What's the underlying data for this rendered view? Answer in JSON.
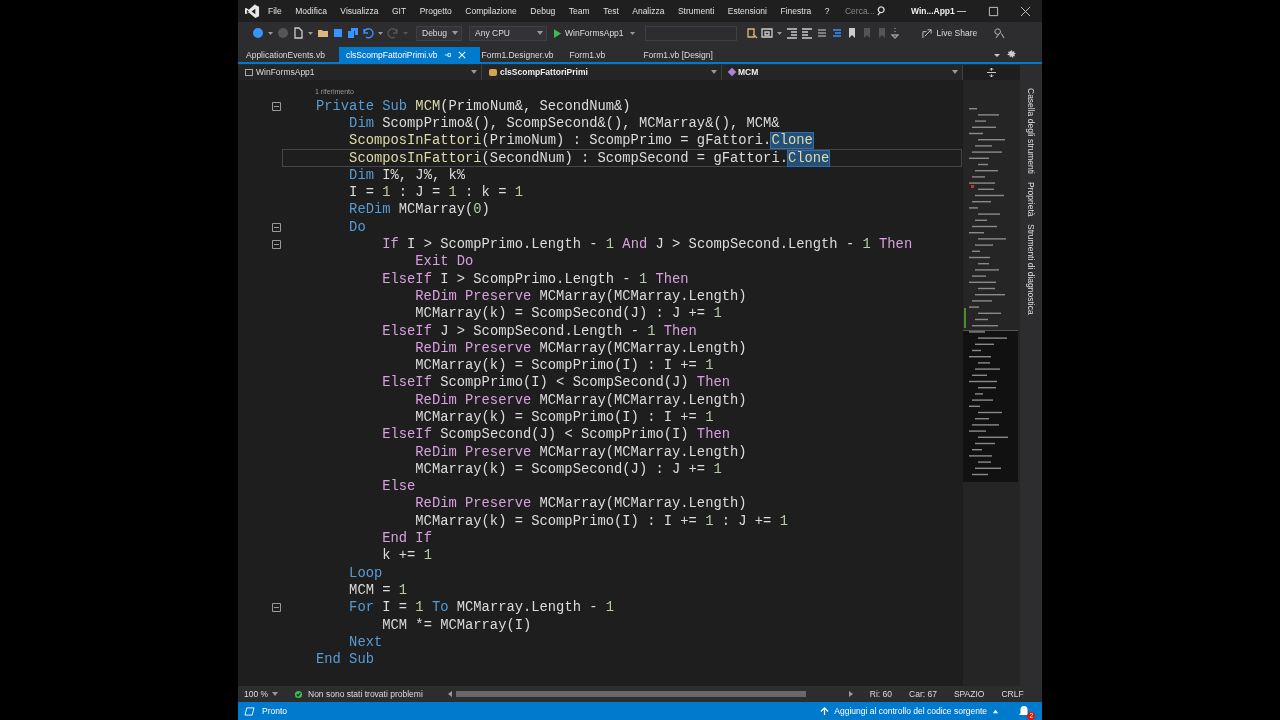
{
  "window": {
    "title": "Win...App1"
  },
  "menu": [
    "File",
    "Modifica",
    "Visualizza",
    "GIT",
    "Progetto",
    "Compilazione",
    "Debug",
    "Team",
    "Test",
    "Analizza",
    "Strumenti",
    "Estensioni",
    "Finestra",
    "?"
  ],
  "search": {
    "placeholder": "Cerca..."
  },
  "toolbar": {
    "configuration": "Debug",
    "platform": "Any CPU",
    "start": "WinFormsApp1",
    "live_share": "Live Share"
  },
  "tabs": [
    {
      "label": "ApplicationEvents.vb",
      "selected": false
    },
    {
      "label": "clsScompFattoriPrimi.vb",
      "selected": true
    },
    {
      "label": "Form1.Designer.vb",
      "selected": false
    },
    {
      "label": "Form1.vb",
      "selected": false
    },
    {
      "label": "Form1.vb [Design]",
      "selected": false
    }
  ],
  "nav_bar": {
    "project": "WinFormsApp1",
    "class": "clsScompFattoriPrimi",
    "member": "MCM"
  },
  "editor": {
    "annotation": "1 riferimento",
    "lines": [
      {
        "fold": true,
        "selected": false,
        "tokens": [
          {
            "kind": "kw",
            "text": "Private Sub "
          },
          {
            "kind": "fn",
            "text": "MCM"
          },
          {
            "kind": "tx",
            "text": "(PrimoNum&, SecondNum&)"
          }
        ],
        "children": [
          {
            "fold": false,
            "selected": false,
            "tokens": [
              {
                "kind": "kw",
                "text": "Dim "
              },
              {
                "kind": "tx",
                "text": "ScompPrimo&(), ScompSecond&(), MCMarray&(), MCM&"
              }
            ]
          },
          {
            "fold": false,
            "selected": false,
            "tokens": [
              {
                "kind": "fn",
                "text": "ScomposInFattori"
              },
              {
                "kind": "tx",
                "text": "(PrimoNum) : ScompPrimo = gFattori."
              },
              {
                "kind": "hl",
                "text": "Clone"
              }
            ]
          },
          {
            "fold": false,
            "selected": true,
            "tokens": [
              {
                "kind": "fn",
                "text": "ScomposInFattori"
              },
              {
                "kind": "tx",
                "text": "(SecondNum) : ScompSecond = gFattori."
              },
              {
                "kind": "hl",
                "text": "Clone"
              }
            ]
          },
          {
            "fold": false,
            "selected": false,
            "tokens": [
              {
                "kind": "kw",
                "text": "Dim "
              },
              {
                "kind": "tx",
                "text": "I%, J%, k%"
              }
            ]
          },
          {
            "fold": false,
            "selected": false,
            "tokens": [
              {
                "kind": "tx",
                "text": "I = "
              },
              {
                "kind": "num",
                "text": "1"
              },
              {
                "kind": "tx",
                "text": " : J = "
              },
              {
                "kind": "num",
                "text": "1"
              },
              {
                "kind": "tx",
                "text": " : k = "
              },
              {
                "kind": "num",
                "text": "1"
              }
            ]
          },
          {
            "fold": false,
            "selected": false,
            "tokens": [
              {
                "kind": "kw",
                "text": "ReDim "
              },
              {
                "kind": "tx",
                "text": "MCMarray("
              },
              {
                "kind": "num",
                "text": "0"
              },
              {
                "kind": "tx",
                "text": ")"
              }
            ]
          },
          {
            "fold": true,
            "selected": false,
            "tokens": [
              {
                "kind": "kw",
                "text": "Do"
              }
            ],
            "children": [
              {
                "fold": true,
                "selected": false,
                "tokens": [
                  {
                    "kind": "ctl",
                    "text": "If "
                  },
                  {
                    "kind": "tx",
                    "text": "I > ScompPrimo.Length - "
                  },
                  {
                    "kind": "num",
                    "text": "1"
                  },
                  {
                    "kind": "ctl",
                    "text": " And "
                  },
                  {
                    "kind": "tx",
                    "text": "J > ScompSecond.Length - "
                  },
                  {
                    "kind": "num",
                    "text": "1"
                  },
                  {
                    "kind": "ctl",
                    "text": " Then"
                  }
                ],
                "children": [
                  {
                    "fold": false,
                    "selected": false,
                    "tokens": [
                      {
                        "kind": "ctl",
                        "text": "Exit Do"
                      }
                    ]
                  }
                ]
              },
              {
                "fold": false,
                "selected": false,
                "tokens": [
                  {
                    "kind": "ctl",
                    "text": "ElseIf "
                  },
                  {
                    "kind": "tx",
                    "text": "I > ScompPrimo.Length - "
                  },
                  {
                    "kind": "num",
                    "text": "1"
                  },
                  {
                    "kind": "ctl",
                    "text": " Then"
                  }
                ],
                "children": [
                  {
                    "fold": false,
                    "selected": false,
                    "tokens": [
                      {
                        "kind": "ctl",
                        "text": "ReDim Preserve "
                      },
                      {
                        "kind": "tx",
                        "text": "MCMarray(MCMarray.Length)"
                      }
                    ]
                  },
                  {
                    "fold": false,
                    "selected": false,
                    "tokens": [
                      {
                        "kind": "tx",
                        "text": "MCMarray(k) = ScompSecond(J) : J += "
                      },
                      {
                        "kind": "num",
                        "text": "1"
                      }
                    ]
                  }
                ]
              },
              {
                "fold": false,
                "selected": false,
                "tokens": [
                  {
                    "kind": "ctl",
                    "text": "ElseIf "
                  },
                  {
                    "kind": "tx",
                    "text": "J > ScompSecond.Length - "
                  },
                  {
                    "kind": "num",
                    "text": "1"
                  },
                  {
                    "kind": "ctl",
                    "text": " Then"
                  }
                ],
                "children": [
                  {
                    "fold": false,
                    "selected": false,
                    "tokens": [
                      {
                        "kind": "ctl",
                        "text": "ReDim Preserve "
                      },
                      {
                        "kind": "tx",
                        "text": "MCMarray(MCMarray.Length)"
                      }
                    ]
                  },
                  {
                    "fold": false,
                    "selected": false,
                    "tokens": [
                      {
                        "kind": "tx",
                        "text": "MCMarray(k) = ScompPrimo(I) : I += "
                      },
                      {
                        "kind": "num",
                        "text": "1"
                      }
                    ]
                  }
                ]
              },
              {
                "fold": false,
                "selected": false,
                "tokens": [
                  {
                    "kind": "ctl",
                    "text": "ElseIf "
                  },
                  {
                    "kind": "tx",
                    "text": "ScompPrimo(I) < ScompSecond(J)"
                  },
                  {
                    "kind": "ctl",
                    "text": " Then"
                  }
                ],
                "children": [
                  {
                    "fold": false,
                    "selected": false,
                    "tokens": [
                      {
                        "kind": "ctl",
                        "text": "ReDim Preserve "
                      },
                      {
                        "kind": "tx",
                        "text": "MCMarray(MCMarray.Length)"
                      }
                    ]
                  },
                  {
                    "fold": false,
                    "selected": false,
                    "tokens": [
                      {
                        "kind": "tx",
                        "text": "MCMarray(k) = ScompPrimo(I) : I += "
                      },
                      {
                        "kind": "num",
                        "text": "1"
                      }
                    ]
                  }
                ]
              },
              {
                "fold": false,
                "selected": false,
                "tokens": [
                  {
                    "kind": "ctl",
                    "text": "ElseIf "
                  },
                  {
                    "kind": "tx",
                    "text": "ScompSecond(J) < ScompPrimo(I)"
                  },
                  {
                    "kind": "ctl",
                    "text": " Then"
                  }
                ],
                "children": [
                  {
                    "fold": false,
                    "selected": false,
                    "tokens": [
                      {
                        "kind": "ctl",
                        "text": "ReDim Preserve "
                      },
                      {
                        "kind": "tx",
                        "text": "MCMarray(MCMarray.Length)"
                      }
                    ]
                  },
                  {
                    "fold": false,
                    "selected": false,
                    "tokens": [
                      {
                        "kind": "tx",
                        "text": "MCMarray(k) = ScompSecond(J) : J += "
                      },
                      {
                        "kind": "num",
                        "text": "1"
                      }
                    ]
                  }
                ]
              },
              {
                "fold": false,
                "selected": false,
                "tokens": [
                  {
                    "kind": "ctl",
                    "text": "Else"
                  }
                ],
                "children": [
                  {
                    "fold": false,
                    "selected": false,
                    "tokens": [
                      {
                        "kind": "ctl",
                        "text": "ReDim Preserve "
                      },
                      {
                        "kind": "tx",
                        "text": "MCMarray(MCMarray.Length)"
                      }
                    ]
                  },
                  {
                    "fold": false,
                    "selected": false,
                    "tokens": [
                      {
                        "kind": "tx",
                        "text": "MCMarray(k) = ScompPrimo(I) : I += "
                      },
                      {
                        "kind": "num",
                        "text": "1"
                      },
                      {
                        "kind": "tx",
                        "text": " : J += "
                      },
                      {
                        "kind": "num",
                        "text": "1"
                      }
                    ]
                  }
                ]
              },
              {
                "fold": false,
                "selected": false,
                "tokens": [
                  {
                    "kind": "ctl",
                    "text": "End If"
                  }
                ]
              },
              {
                "fold": false,
                "selected": false,
                "tokens": [
                  {
                    "kind": "tx",
                    "text": "k += "
                  },
                  {
                    "kind": "num",
                    "text": "1"
                  }
                ]
              }
            ]
          },
          {
            "fold": false,
            "selected": false,
            "tokens": [
              {
                "kind": "kw",
                "text": "Loop"
              }
            ]
          },
          {
            "fold": false,
            "selected": false,
            "tokens": [
              {
                "kind": "tx",
                "text": "MCM = "
              },
              {
                "kind": "num",
                "text": "1"
              }
            ]
          },
          {
            "fold": true,
            "selected": false,
            "tokens": [
              {
                "kind": "kw",
                "text": "For "
              },
              {
                "kind": "tx",
                "text": "I = "
              },
              {
                "kind": "num",
                "text": "1"
              },
              {
                "kind": "kw",
                "text": " To "
              },
              {
                "kind": "tx",
                "text": "MCMarray.Length - "
              },
              {
                "kind": "num",
                "text": "1"
              }
            ],
            "children": [
              {
                "fold": false,
                "selected": false,
                "tokens": [
                  {
                    "kind": "tx",
                    "text": "MCM *= MCMarray(I)"
                  }
                ]
              }
            ]
          },
          {
            "fold": false,
            "selected": false,
            "tokens": [
              {
                "kind": "kw",
                "text": "Next"
              }
            ]
          }
        ]
      },
      {
        "fold": false,
        "selected": false,
        "tokens": [
          {
            "kind": "kw",
            "text": "End Sub"
          }
        ]
      }
    ]
  },
  "side_tabs": [
    "Casella degli strumenti",
    "Proprietà",
    "Strumenti di diagnostica"
  ],
  "editor_footer": {
    "zoom": "100 %",
    "issues": "Non sono stati trovati problemi",
    "line": "Ri: 60",
    "column": "Car: 67",
    "indent": "SPAZIO",
    "line_ending": "CRLF"
  },
  "status_bar": {
    "text": "Pronto",
    "source_control": "Aggiungi al controllo del codice sorgente",
    "notifications": "2"
  }
}
